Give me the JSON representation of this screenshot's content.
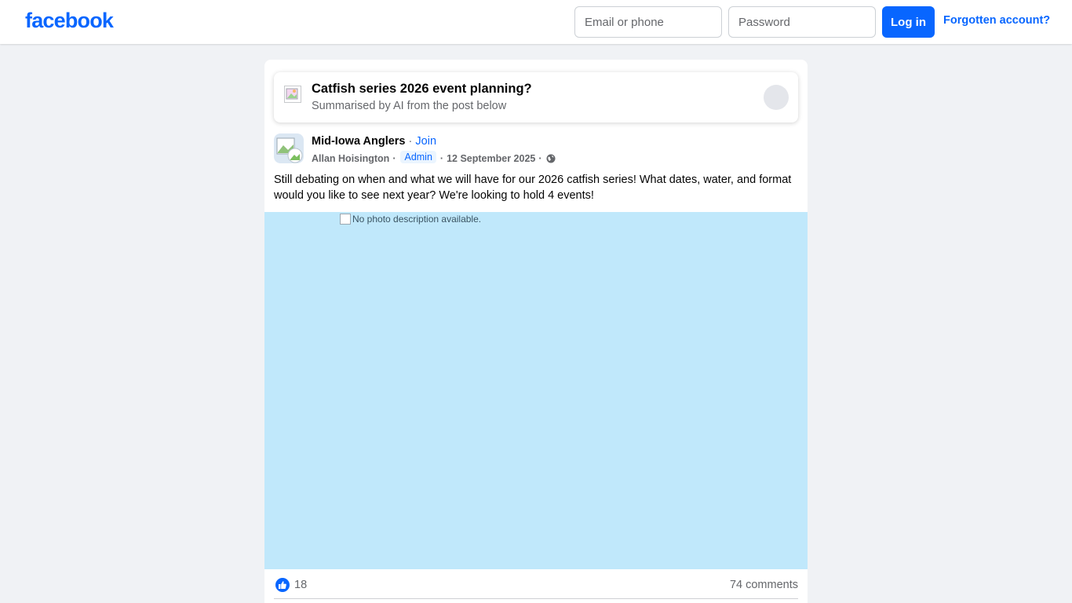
{
  "header": {
    "logo": "facebook",
    "email_placeholder": "Email or phone",
    "password_placeholder": "Password",
    "login_label": "Log in",
    "forgot_label": "Forgotten account?"
  },
  "summary": {
    "title": "Catfish series 2026 event planning?",
    "subtitle": "Summarised by AI from the post below"
  },
  "post": {
    "group_name": "Mid-Iowa Anglers",
    "separator": "·",
    "join_label": "Join",
    "author": "Allan Hoisington",
    "author_badge": "Admin",
    "date": "12 September 2025",
    "text": "Still debating on when and what we will have for our 2026 catfish series! What dates, water, and format would you like to see next year? We're looking to hold 4 events!",
    "photo_alt": "No photo description available.",
    "like_count": "18",
    "comments_label": "74 comments"
  },
  "colors": {
    "brand": "#0866ff",
    "photo_bg": "#c0e8fb",
    "page_bg": "#f0f2f5"
  },
  "icons": [
    "globe-icon",
    "like-icon",
    "broken-image-icon"
  ]
}
